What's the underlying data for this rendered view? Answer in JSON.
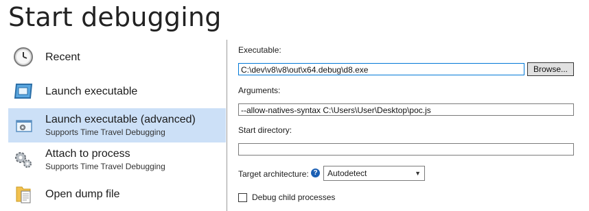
{
  "page_title": "Start debugging",
  "nav": {
    "items": [
      {
        "label": "Recent",
        "sub": ""
      },
      {
        "label": "Launch executable",
        "sub": ""
      },
      {
        "label": "Launch executable (advanced)",
        "sub": "Supports Time Travel Debugging"
      },
      {
        "label": "Attach to process",
        "sub": "Supports Time Travel Debugging"
      },
      {
        "label": "Open dump file",
        "sub": ""
      }
    ],
    "selected_index": 2
  },
  "form": {
    "executable": {
      "label": "Executable:",
      "value": "C:\\dev\\v8\\v8\\out\\x64.debug\\d8.exe"
    },
    "browse_label": "Browse...",
    "arguments": {
      "label": "Arguments:",
      "value": "--allow-natives-syntax C:\\Users\\User\\Desktop\\poc.js"
    },
    "start_directory": {
      "label": "Start directory:",
      "value": ""
    },
    "target_architecture": {
      "label": "Target architecture:",
      "selected": "Autodetect"
    },
    "debug_child": {
      "label": "Debug child processes",
      "checked": false
    }
  },
  "colors": {
    "selection": "#cce0f7",
    "accent": "#0078d7"
  }
}
